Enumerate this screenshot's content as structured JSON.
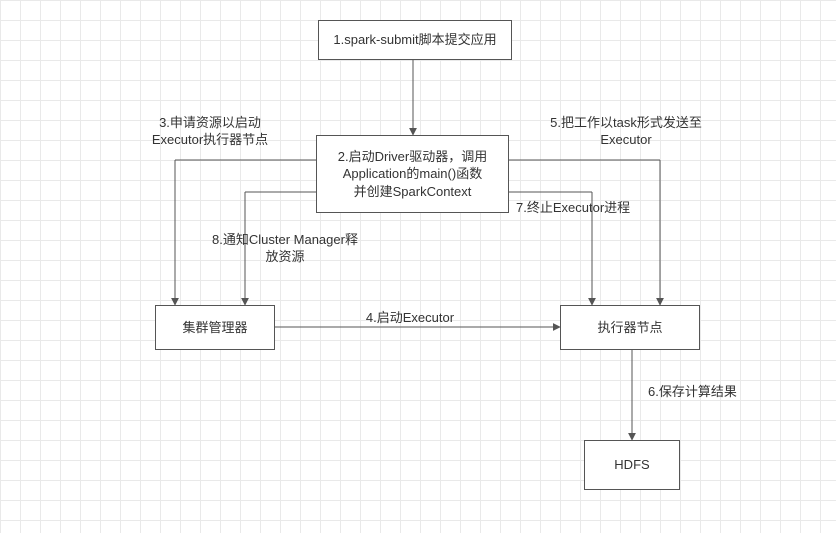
{
  "nodes": {
    "submit": {
      "label": "1.spark-submit脚本提交应用"
    },
    "driver": {
      "label": "2.启动Driver驱动器，调用\nApplication的main()函数\n并创建SparkContext"
    },
    "clusterMgr": {
      "label": "集群管理器"
    },
    "executor": {
      "label": "执行器节点"
    },
    "hdfs": {
      "label": "HDFS"
    }
  },
  "edges": {
    "e3": {
      "label": "3.申请资源以启动\nExecutor执行器节点"
    },
    "e4": {
      "label": "4.启动Executor"
    },
    "e5": {
      "label": "5.把工作以task形式发送至\nExecutor"
    },
    "e6": {
      "label": "6.保存计算结果"
    },
    "e7": {
      "label": "7.终止Executor进程"
    },
    "e8": {
      "label": "8.通知Cluster Manager释\n放资源"
    }
  },
  "chart_data": {
    "type": "flow",
    "title": "",
    "nodes": [
      {
        "id": "submit",
        "label": "1.spark-submit脚本提交应用"
      },
      {
        "id": "driver",
        "label": "2.启动Driver驱动器，调用Application的main()函数并创建SparkContext"
      },
      {
        "id": "clusterMgr",
        "label": "集群管理器"
      },
      {
        "id": "executor",
        "label": "执行器节点"
      },
      {
        "id": "hdfs",
        "label": "HDFS"
      }
    ],
    "edges": [
      {
        "from": "submit",
        "to": "driver",
        "label": "",
        "step": 1
      },
      {
        "from": "driver",
        "to": "clusterMgr",
        "label": "3.申请资源以启动Executor执行器节点",
        "step": 3
      },
      {
        "from": "clusterMgr",
        "to": "executor",
        "label": "4.启动Executor",
        "step": 4
      },
      {
        "from": "driver",
        "to": "executor",
        "label": "5.把工作以task形式发送至Executor",
        "step": 5
      },
      {
        "from": "executor",
        "to": "hdfs",
        "label": "6.保存计算结果",
        "step": 6
      },
      {
        "from": "driver",
        "to": "executor",
        "label": "7.终止Executor进程",
        "step": 7
      },
      {
        "from": "driver",
        "to": "clusterMgr",
        "label": "8.通知Cluster Manager释放资源",
        "step": 8
      }
    ]
  }
}
